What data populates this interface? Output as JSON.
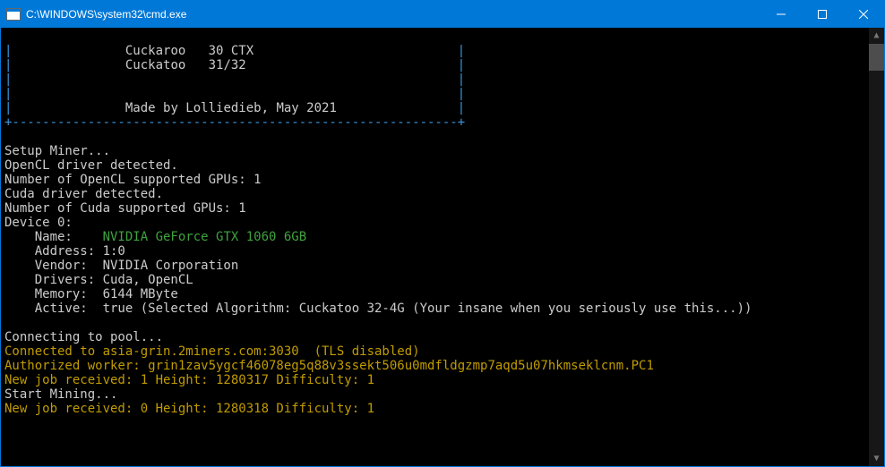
{
  "titlebar": {
    "title": "C:\\WINDOWS\\system32\\cmd.exe"
  },
  "banner": {
    "line1_left": "|",
    "line1_mid": "Cuckaroo   30 CTX",
    "line1_right": "|",
    "line2_left": "|",
    "line2_mid": "Cuckatoo   31/32",
    "line2_right": "|",
    "line3_left": "|",
    "line3_right": "|",
    "line4_left": "|",
    "line4_right": "|",
    "line5_left": "|",
    "line5_mid": "Made by Lolliedieb, May 2021",
    "line5_right": "|",
    "border": "+-----------------------------------------------------------+"
  },
  "setup": {
    "l1": "Setup Miner...",
    "l2": "OpenCL driver detected.",
    "l3": "Number of OpenCL supported GPUs: 1",
    "l4": "Cuda driver detected.",
    "l5": "Number of Cuda supported GPUs: 1",
    "l6": "Device 0:"
  },
  "device": {
    "name_label": "    Name:    ",
    "name_value": "NVIDIA GeForce GTX 1060 6GB",
    "address": "    Address: 1:0",
    "vendor": "    Vendor:  NVIDIA Corporation",
    "drivers": "    Drivers: Cuda, OpenCL",
    "memory": "    Memory:  6144 MByte",
    "active": "    Active:  true (Selected Algorithm: Cuckatoo 32-4G (Your insane when you seriously use this...))"
  },
  "pool": {
    "connecting": "Connecting to pool...",
    "connected": "Connected to asia-grin.2miners.com:3030  (TLS disabled)",
    "authorized": "Authorized worker: grin1zav5ygcf46078eg5q88v3ssekt506u0mdfldgzmp7aqd5u07hkmseklcnm.PC1",
    "job1": "New job received: 1 Height: 1280317 Difficulty: 1",
    "start": "Start Mining...",
    "job2": "New job received: 0 Height: 1280318 Difficulty: 1"
  }
}
